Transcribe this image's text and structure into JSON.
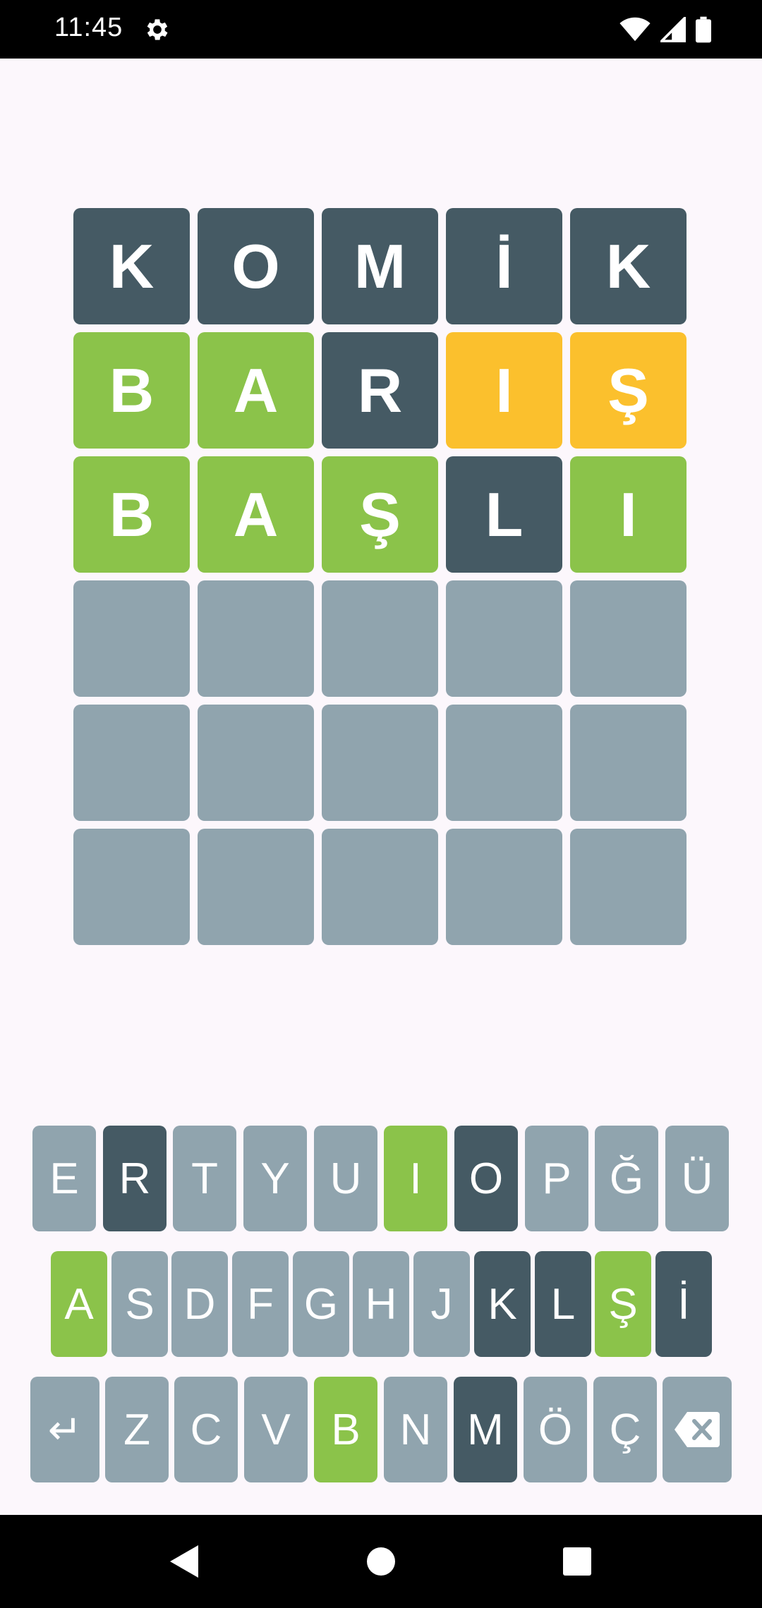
{
  "colors": {
    "correct": "#8bc34a",
    "present": "#fbc02d",
    "absent": "#455a64",
    "empty": "#90a4ae",
    "background": "#fcf7fc"
  },
  "status_bar": {
    "time": "11:45",
    "icons": [
      "gear-icon",
      "wifi-icon",
      "signal-icon",
      "battery-icon"
    ]
  },
  "board": {
    "rows": [
      [
        {
          "letter": "K",
          "state": "absent"
        },
        {
          "letter": "O",
          "state": "absent"
        },
        {
          "letter": "M",
          "state": "absent"
        },
        {
          "letter": "İ",
          "state": "absent"
        },
        {
          "letter": "K",
          "state": "absent"
        }
      ],
      [
        {
          "letter": "B",
          "state": "correct"
        },
        {
          "letter": "A",
          "state": "correct"
        },
        {
          "letter": "R",
          "state": "absent"
        },
        {
          "letter": "I",
          "state": "present"
        },
        {
          "letter": "Ş",
          "state": "present"
        }
      ],
      [
        {
          "letter": "B",
          "state": "correct"
        },
        {
          "letter": "A",
          "state": "correct"
        },
        {
          "letter": "Ş",
          "state": "correct"
        },
        {
          "letter": "L",
          "state": "absent"
        },
        {
          "letter": "I",
          "state": "correct"
        }
      ],
      [
        {
          "letter": "",
          "state": "empty"
        },
        {
          "letter": "",
          "state": "empty"
        },
        {
          "letter": "",
          "state": "empty"
        },
        {
          "letter": "",
          "state": "empty"
        },
        {
          "letter": "",
          "state": "empty"
        }
      ],
      [
        {
          "letter": "",
          "state": "empty"
        },
        {
          "letter": "",
          "state": "empty"
        },
        {
          "letter": "",
          "state": "empty"
        },
        {
          "letter": "",
          "state": "empty"
        },
        {
          "letter": "",
          "state": "empty"
        }
      ],
      [
        {
          "letter": "",
          "state": "empty"
        },
        {
          "letter": "",
          "state": "empty"
        },
        {
          "letter": "",
          "state": "empty"
        },
        {
          "letter": "",
          "state": "empty"
        },
        {
          "letter": "",
          "state": "empty"
        }
      ]
    ]
  },
  "keyboard": {
    "rows": [
      [
        {
          "label": "E",
          "state": "empty"
        },
        {
          "label": "R",
          "state": "absent"
        },
        {
          "label": "T",
          "state": "empty"
        },
        {
          "label": "Y",
          "state": "empty"
        },
        {
          "label": "U",
          "state": "empty"
        },
        {
          "label": "I",
          "state": "correct"
        },
        {
          "label": "O",
          "state": "absent"
        },
        {
          "label": "P",
          "state": "empty"
        },
        {
          "label": "Ğ",
          "state": "empty"
        },
        {
          "label": "Ü",
          "state": "empty"
        }
      ],
      [
        {
          "label": "A",
          "state": "correct"
        },
        {
          "label": "S",
          "state": "empty"
        },
        {
          "label": "D",
          "state": "empty"
        },
        {
          "label": "F",
          "state": "empty"
        },
        {
          "label": "G",
          "state": "empty"
        },
        {
          "label": "H",
          "state": "empty"
        },
        {
          "label": "J",
          "state": "empty"
        },
        {
          "label": "K",
          "state": "absent"
        },
        {
          "label": "L",
          "state": "absent"
        },
        {
          "label": "Ş",
          "state": "correct"
        },
        {
          "label": "İ",
          "state": "absent"
        }
      ],
      [
        {
          "label": "↵",
          "state": "empty",
          "icon": "enter-icon"
        },
        {
          "label": "Z",
          "state": "empty"
        },
        {
          "label": "C",
          "state": "empty"
        },
        {
          "label": "V",
          "state": "empty"
        },
        {
          "label": "B",
          "state": "correct"
        },
        {
          "label": "N",
          "state": "empty"
        },
        {
          "label": "M",
          "state": "absent"
        },
        {
          "label": "Ö",
          "state": "empty"
        },
        {
          "label": "Ç",
          "state": "empty"
        },
        {
          "label": "",
          "state": "empty",
          "icon": "backspace-icon"
        }
      ]
    ]
  },
  "nav_bar": {
    "icons": [
      "back-icon",
      "home-icon",
      "recents-icon"
    ]
  }
}
